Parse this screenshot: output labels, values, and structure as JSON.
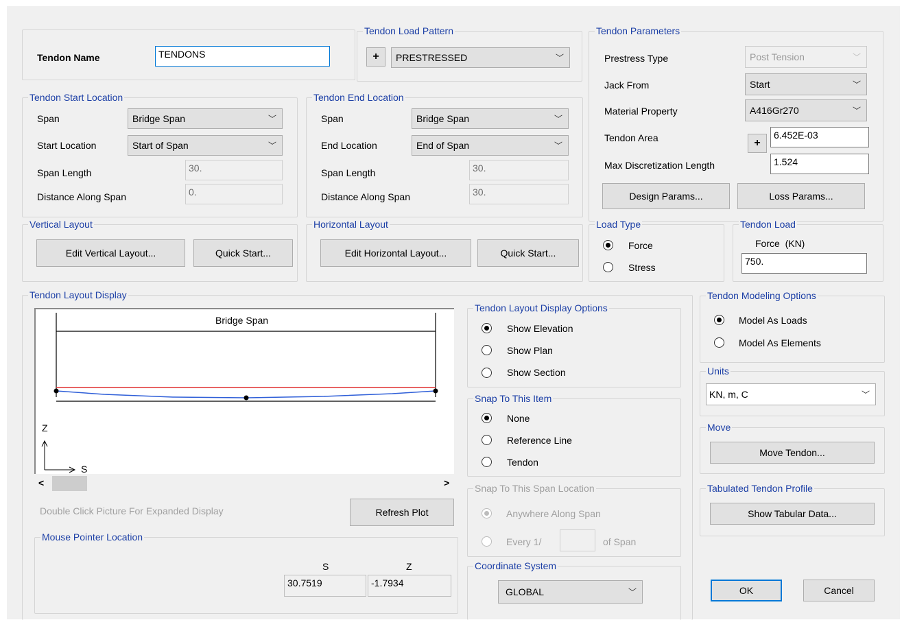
{
  "tendon_name": {
    "label": "Tendon Name",
    "value": "TENDONS"
  },
  "load_pattern": {
    "title": "Tendon Load Pattern",
    "plus": "+",
    "value": "PRESTRESSED"
  },
  "parameters": {
    "title": "Tendon Parameters",
    "prestress_type_label": "Prestress Type",
    "prestress_type": "Post Tension",
    "jack_from_label": "Jack From",
    "jack_from": "Start",
    "material_label": "Material Property",
    "material": "A416Gr270",
    "area_label": "Tendon Area",
    "area_plus": "+",
    "area": "6.452E-03",
    "max_disc_label": "Max Discretization Length",
    "max_disc": "1.524",
    "design_params": "Design Params...",
    "loss_params": "Loss Params..."
  },
  "start_location": {
    "title": "Tendon Start Location",
    "span_label": "Span",
    "span": "Bridge Span",
    "loc_label": "Start Location",
    "loc": "Start of Span",
    "length_label": "Span Length",
    "length": "30.",
    "distance_label": "Distance Along Span",
    "distance": "0."
  },
  "end_location": {
    "title": "Tendon End Location",
    "span_label": "Span",
    "span": "Bridge Span",
    "loc_label": "End Location",
    "loc": "End of Span",
    "length_label": "Span Length",
    "length": "30.",
    "distance_label": "Distance Along Span",
    "distance": "30."
  },
  "vertical_layout": {
    "title": "Vertical Layout",
    "edit": "Edit Vertical Layout...",
    "quick": "Quick Start..."
  },
  "horizontal_layout": {
    "title": "Horizontal Layout",
    "edit": "Edit Horizontal Layout...",
    "quick": "Quick Start..."
  },
  "load_type": {
    "title": "Load Type",
    "force": "Force",
    "stress": "Stress",
    "selected": "Force"
  },
  "tendon_load": {
    "title": "Tendon Load",
    "unit_label": "Force  (KN)",
    "value": "750."
  },
  "layout_display": {
    "title": "Tendon Layout Display",
    "span_label": "Bridge Span",
    "axis_z": "Z",
    "axis_s": "S",
    "hint": "Double Click Picture For Expanded Display",
    "refresh": "Refresh Plot",
    "scroll_left": "<",
    "scroll_right": ">"
  },
  "mouse_pointer": {
    "title": "Mouse Pointer Location",
    "s_label": "S",
    "z_label": "Z",
    "s": "30.7519",
    "z": "-1.7934"
  },
  "display_options": {
    "title": "Tendon Layout Display Options",
    "elevation": "Show Elevation",
    "plan": "Show Plan",
    "section": "Show Section",
    "selected": "Show Elevation"
  },
  "snap_item": {
    "title": "Snap To This Item",
    "none": "None",
    "ref_line": "Reference Line",
    "tendon": "Tendon",
    "selected": "None"
  },
  "snap_span": {
    "title": "Snap To This Span Location",
    "anywhere": "Anywhere Along Span",
    "every": "Every 1/",
    "of_span": "of Span",
    "every_value": ""
  },
  "coord_system": {
    "title": "Coordinate System",
    "value": "GLOBAL"
  },
  "modeling": {
    "title": "Tendon Modeling Options",
    "loads": "Model As Loads",
    "elements": "Model As Elements",
    "selected": "Model As Loads"
  },
  "units": {
    "title": "Units",
    "value": "KN, m, C"
  },
  "move": {
    "title": "Move",
    "button": "Move Tendon..."
  },
  "tabulated": {
    "title": "Tabulated Tendon Profile",
    "button": "Show Tabular Data..."
  },
  "ok": "OK",
  "cancel": "Cancel",
  "colors": {
    "group_title": "#1c3fa6",
    "tendon_line": "#2f5fd8",
    "reference_line": "#e03030",
    "default_border": "#0078d7"
  }
}
